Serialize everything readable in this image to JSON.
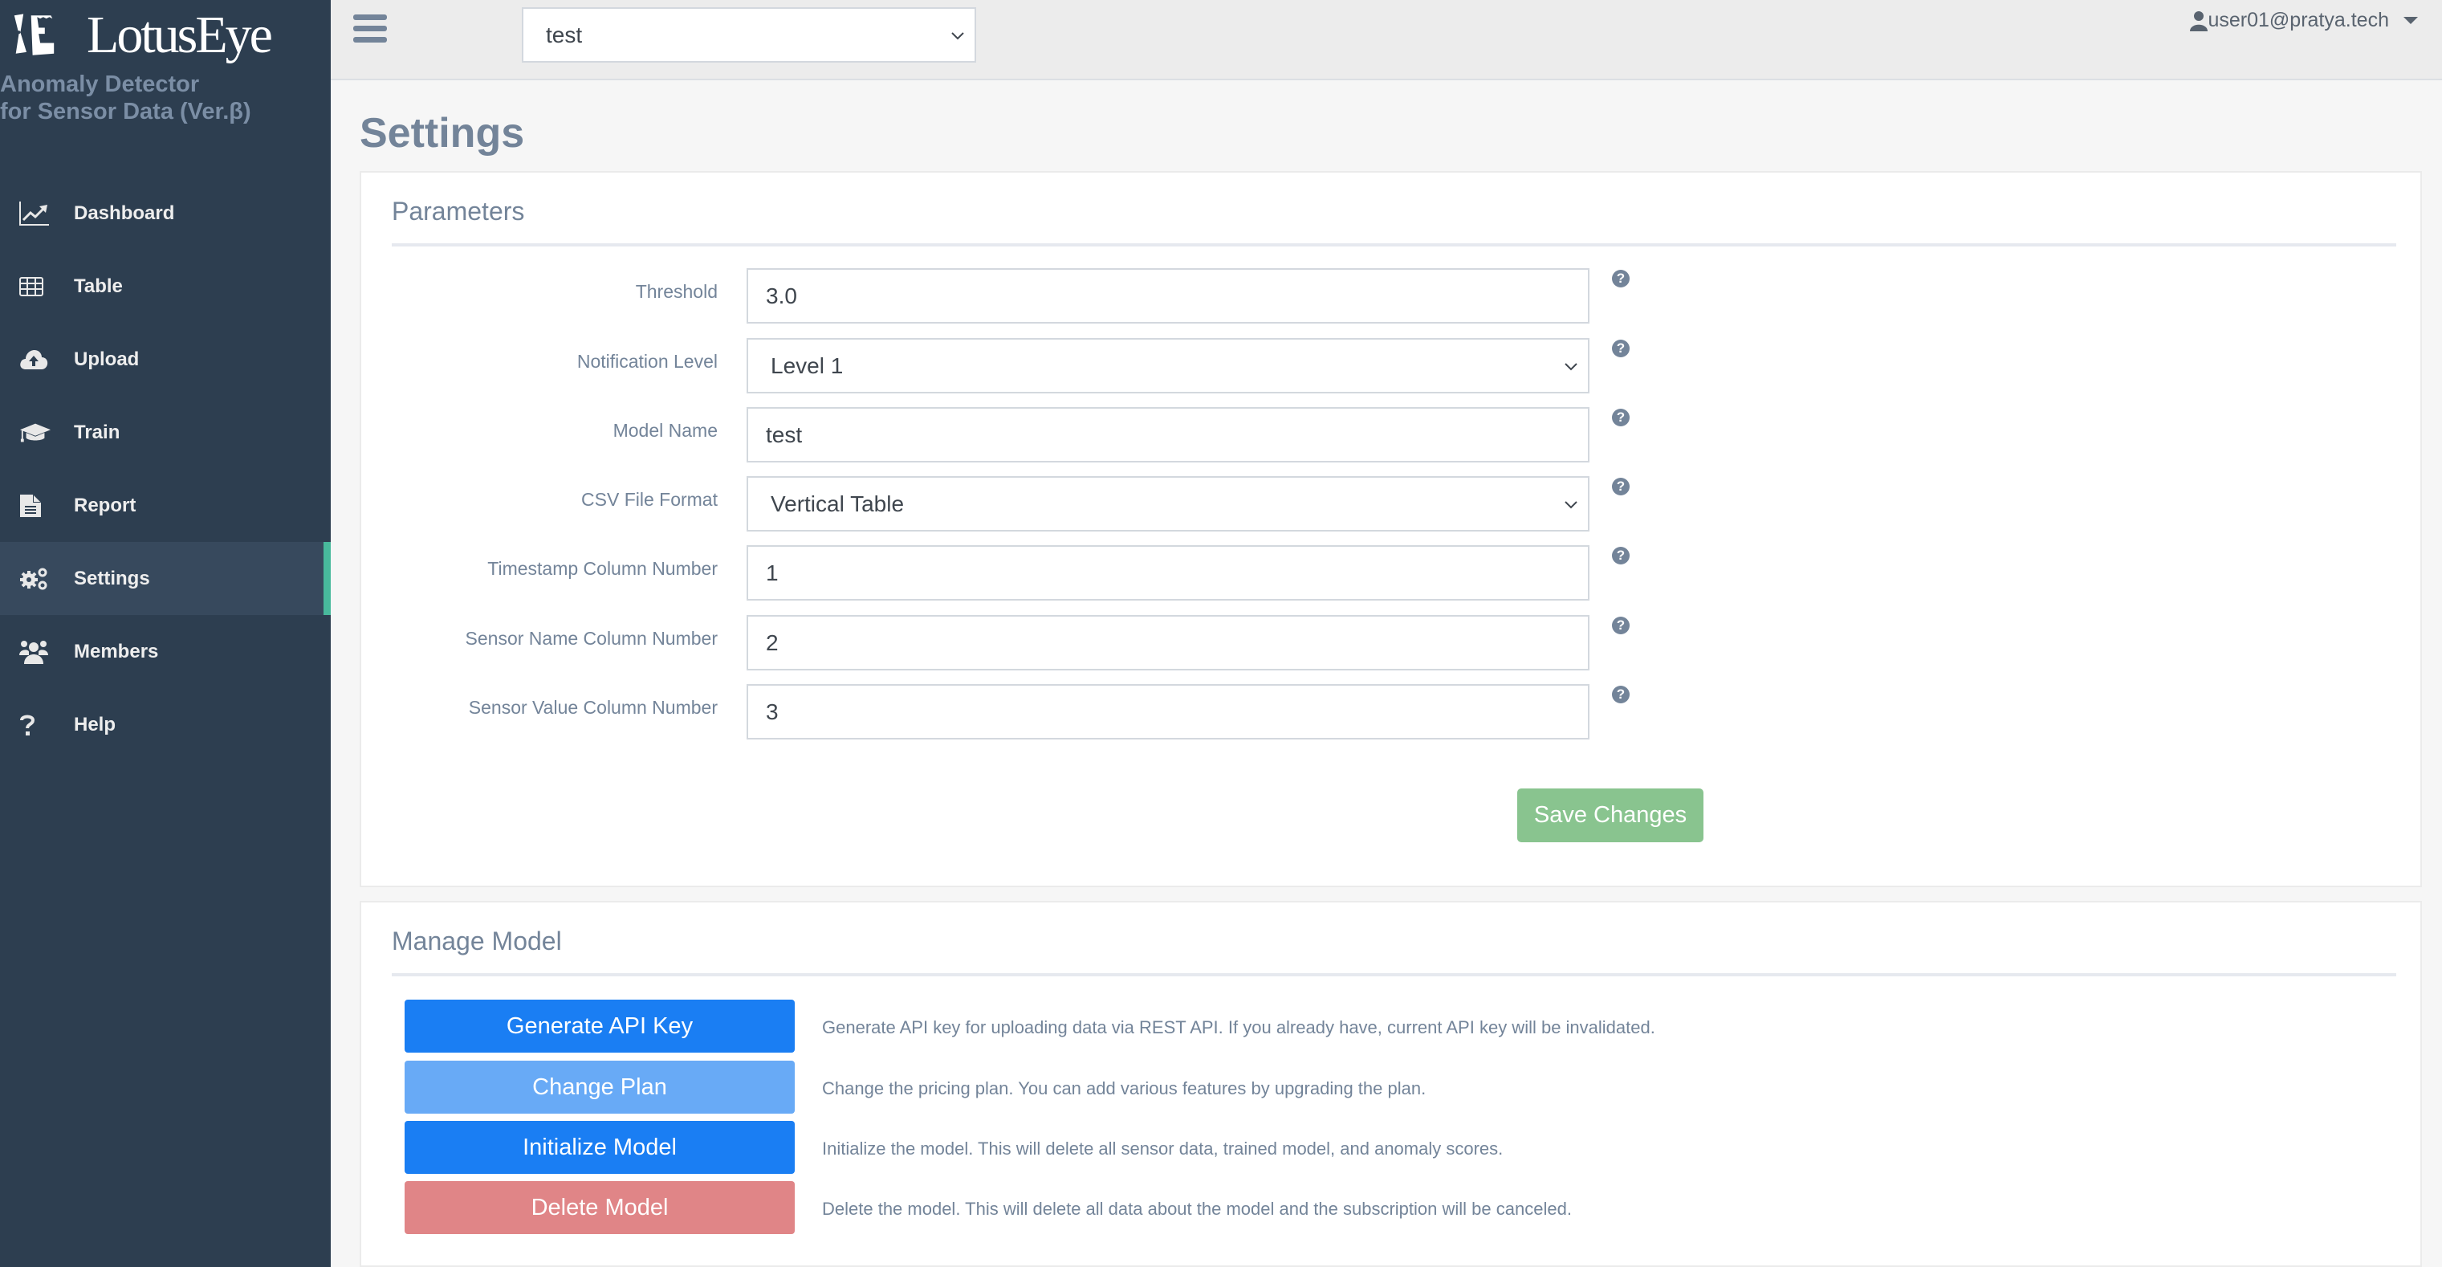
{
  "brand": {
    "name": "LotusEye",
    "subtitle_line1": "Anomaly Detector",
    "subtitle_line2": "for Sensor Data (Ver.β)"
  },
  "sidebar": {
    "active": "Settings",
    "items": [
      {
        "label": "Dashboard",
        "icon": "chart-line-icon"
      },
      {
        "label": "Table",
        "icon": "table-icon"
      },
      {
        "label": "Upload",
        "icon": "cloud-upload-icon"
      },
      {
        "label": "Train",
        "icon": "graduation-cap-icon"
      },
      {
        "label": "Report",
        "icon": "file-text-icon"
      },
      {
        "label": "Settings",
        "icon": "gears-icon"
      },
      {
        "label": "Members",
        "icon": "users-icon"
      },
      {
        "label": "Help",
        "icon": "question-icon"
      }
    ]
  },
  "topbar": {
    "model_select_value": "test",
    "user_email": "user01@pratya.tech"
  },
  "page": {
    "title": "Settings"
  },
  "parameters": {
    "title": "Parameters",
    "fields": [
      {
        "label": "Threshold",
        "type": "input",
        "value": "3.0"
      },
      {
        "label": "Notification Level",
        "type": "select",
        "value": "Level 1"
      },
      {
        "label": "Model Name",
        "type": "input",
        "value": "test"
      },
      {
        "label": "CSV File Format",
        "type": "select",
        "value": "Vertical Table"
      },
      {
        "label": "Timestamp Column Number",
        "type": "input",
        "value": "1"
      },
      {
        "label": "Sensor Name Column Number",
        "type": "input",
        "value": "2"
      },
      {
        "label": "Sensor Value Column Number",
        "type": "input",
        "value": "3"
      }
    ],
    "help_glyph": "?",
    "save_label": "Save Changes"
  },
  "manage": {
    "title": "Manage Model",
    "actions": [
      {
        "label": "Generate API Key",
        "description": "Generate API key for uploading data via REST API. If you already have, current API key will be invalidated."
      },
      {
        "label": "Change Plan",
        "description": "Change the pricing plan. You can add various features by upgrading the plan."
      },
      {
        "label": "Initialize Model",
        "description": "Initialize the model. This will delete all sensor data, trained model, and anomaly scores."
      },
      {
        "label": "Delete Model",
        "description": "Delete the model. This will delete all data about the model and the subscription will be canceled."
      }
    ]
  },
  "colors": {
    "sidebar_bg": "#2d3e50",
    "active_accent": "#48b99c",
    "primary": "#1a7ef3",
    "primary_light": "#68aaf6",
    "danger": "#e08587",
    "success": "#89c48f",
    "muted_text": "#738499"
  }
}
